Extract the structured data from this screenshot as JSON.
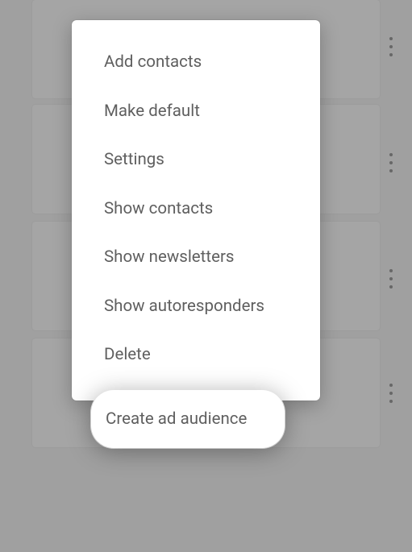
{
  "menu": {
    "items": [
      {
        "label": "Add contacts"
      },
      {
        "label": "Make default"
      },
      {
        "label": "Settings"
      },
      {
        "label": "Show contacts"
      },
      {
        "label": "Show newsletters"
      },
      {
        "label": "Show autoresponders"
      },
      {
        "label": "Delete"
      }
    ],
    "highlighted": {
      "label": "Create ad audience"
    }
  }
}
